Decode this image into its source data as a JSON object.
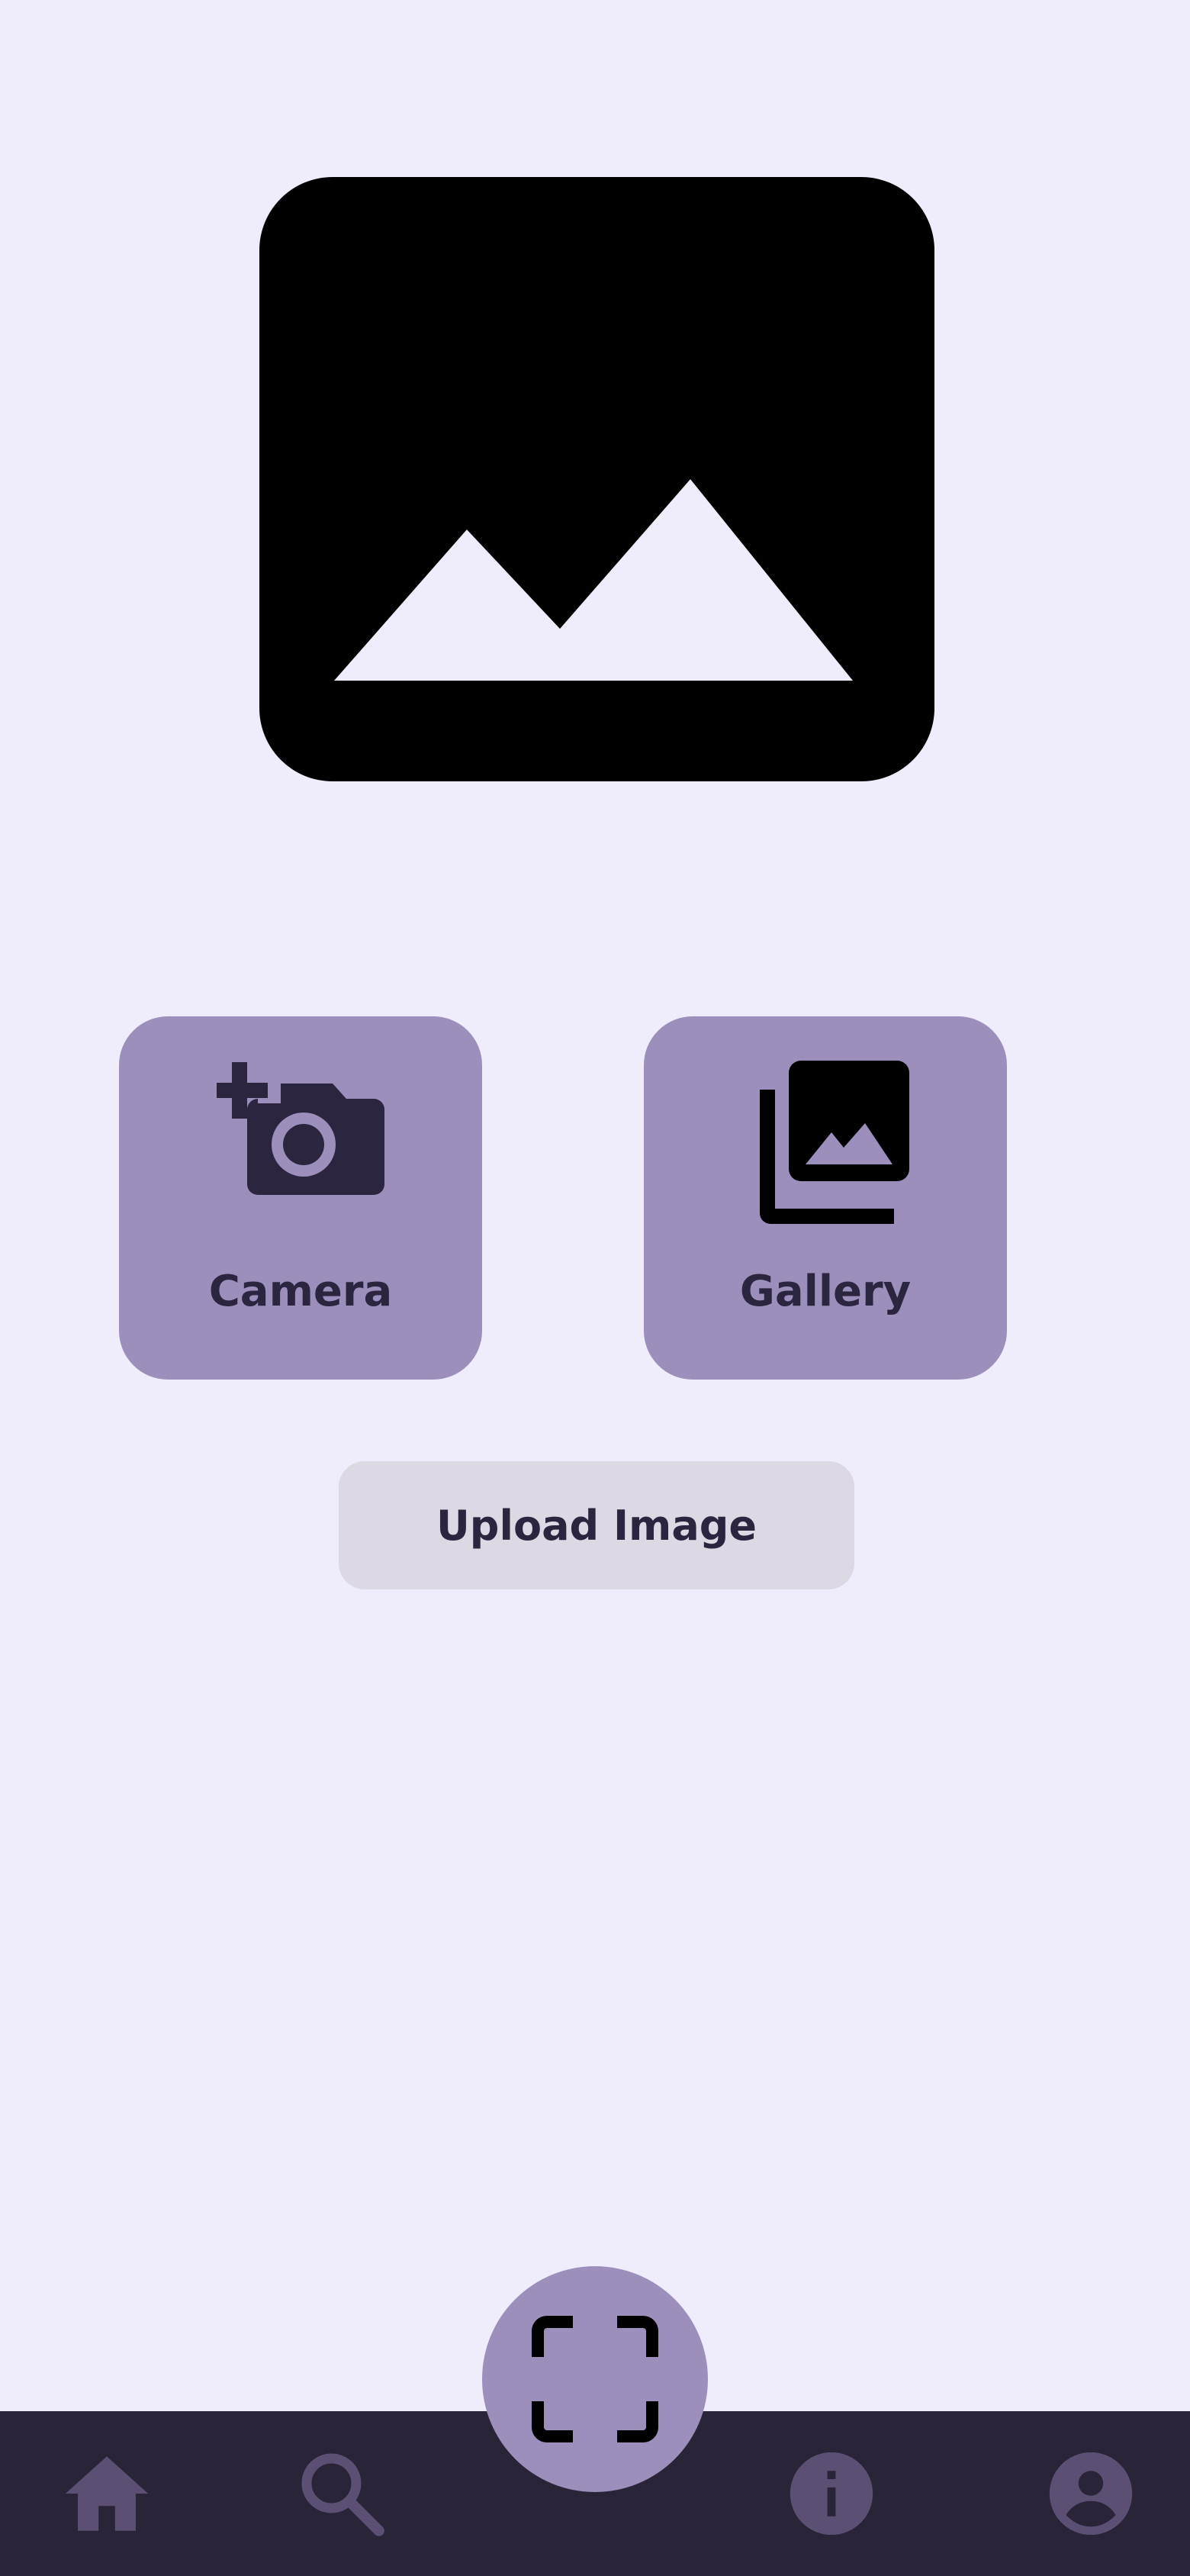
{
  "preview": {
    "icon": "image-placeholder-icon"
  },
  "actions": {
    "camera": {
      "label": "Camera",
      "icon": "add-a-photo-icon"
    },
    "gallery": {
      "label": "Gallery",
      "icon": "photo-library-icon"
    }
  },
  "upload": {
    "label": "Upload Image"
  },
  "bottom_nav": {
    "items": [
      {
        "icon": "home-icon"
      },
      {
        "icon": "search-icon"
      },
      {
        "icon": "scan-icon"
      },
      {
        "icon": "info-icon"
      },
      {
        "icon": "account-icon"
      }
    ]
  },
  "colors": {
    "background": "#efecfb",
    "tile": "#9d8fbc",
    "button": "#dcd9e4",
    "nav_bar": "#2a2438",
    "nav_icon": "#5b5073",
    "text": "#2b2540"
  }
}
